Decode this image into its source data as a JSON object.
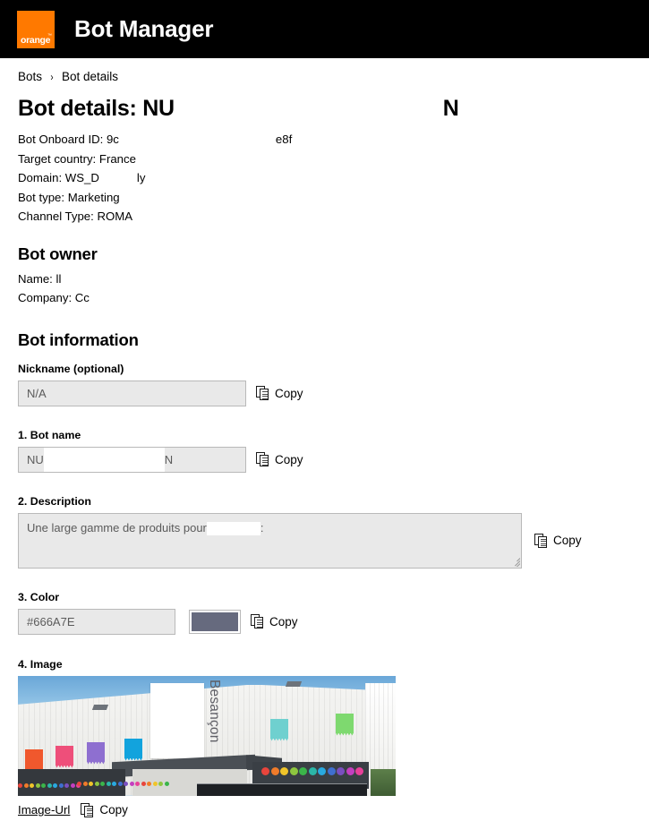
{
  "header": {
    "logo_text": "orange",
    "logo_tm": "™",
    "app_title": "Bot Manager",
    "logo_color": "#ff7900",
    "bar_color": "#000000"
  },
  "breadcrumb": {
    "items": [
      {
        "label": "Bots"
      },
      {
        "label": "Bot details"
      }
    ],
    "separator": "›"
  },
  "page": {
    "title_prefix": "Bot details:",
    "title_value_start": "NU",
    "title_value_end": "N"
  },
  "meta": {
    "onboard_id_label": "Bot Onboard ID:",
    "onboard_id_start": "9c",
    "onboard_id_end": "e8f",
    "target_country": "Target country: France",
    "domain_label": "Domain:",
    "domain_start": "WS_D",
    "domain_end": "ly",
    "bot_type": "Bot type: Marketing",
    "channel_type": "Channel Type: ROMA"
  },
  "owner": {
    "heading": "Bot owner",
    "name_label": "Name:",
    "name_value": "ll",
    "company_label": "Company:",
    "company_value": "Cc"
  },
  "info": {
    "heading": "Bot information",
    "copy_label": "Copy",
    "fields": {
      "nickname": {
        "label": "Nickname (optional)",
        "value": "N/A"
      },
      "bot_name": {
        "label": "1. Bot name",
        "value_start": "NU",
        "value_end": "N"
      },
      "description": {
        "label": "2. Description",
        "value_start": "Une large gamme de produits pour",
        "value_end": ":"
      },
      "color": {
        "label": "3. Color",
        "value": "#666A7E",
        "swatch": "#666A7E"
      },
      "image": {
        "label": "4. Image",
        "link_label": "Image-Url",
        "alt": "Storefront building with Besançon signage and colored panels"
      }
    }
  },
  "image_content": {
    "wall_text": "Besançon",
    "signs": [
      {
        "color": "#f0582d",
        "label": ""
      },
      {
        "color": "#ee4f7a",
        "label": ""
      },
      {
        "color": "#8e6fd0",
        "label": ""
      },
      {
        "color": "#12a3dd",
        "label": ""
      },
      {
        "color": "#6fd0cf",
        "label": ""
      },
      {
        "color": "#7ed96f",
        "label": ""
      }
    ],
    "dot_colors": [
      "#e8453c",
      "#f07b2a",
      "#f0c52a",
      "#8ec63f",
      "#3bb54a",
      "#2bb6a8",
      "#29a9e0",
      "#3f6fd0",
      "#7a4fc0",
      "#c43fc0",
      "#e8409a"
    ]
  }
}
